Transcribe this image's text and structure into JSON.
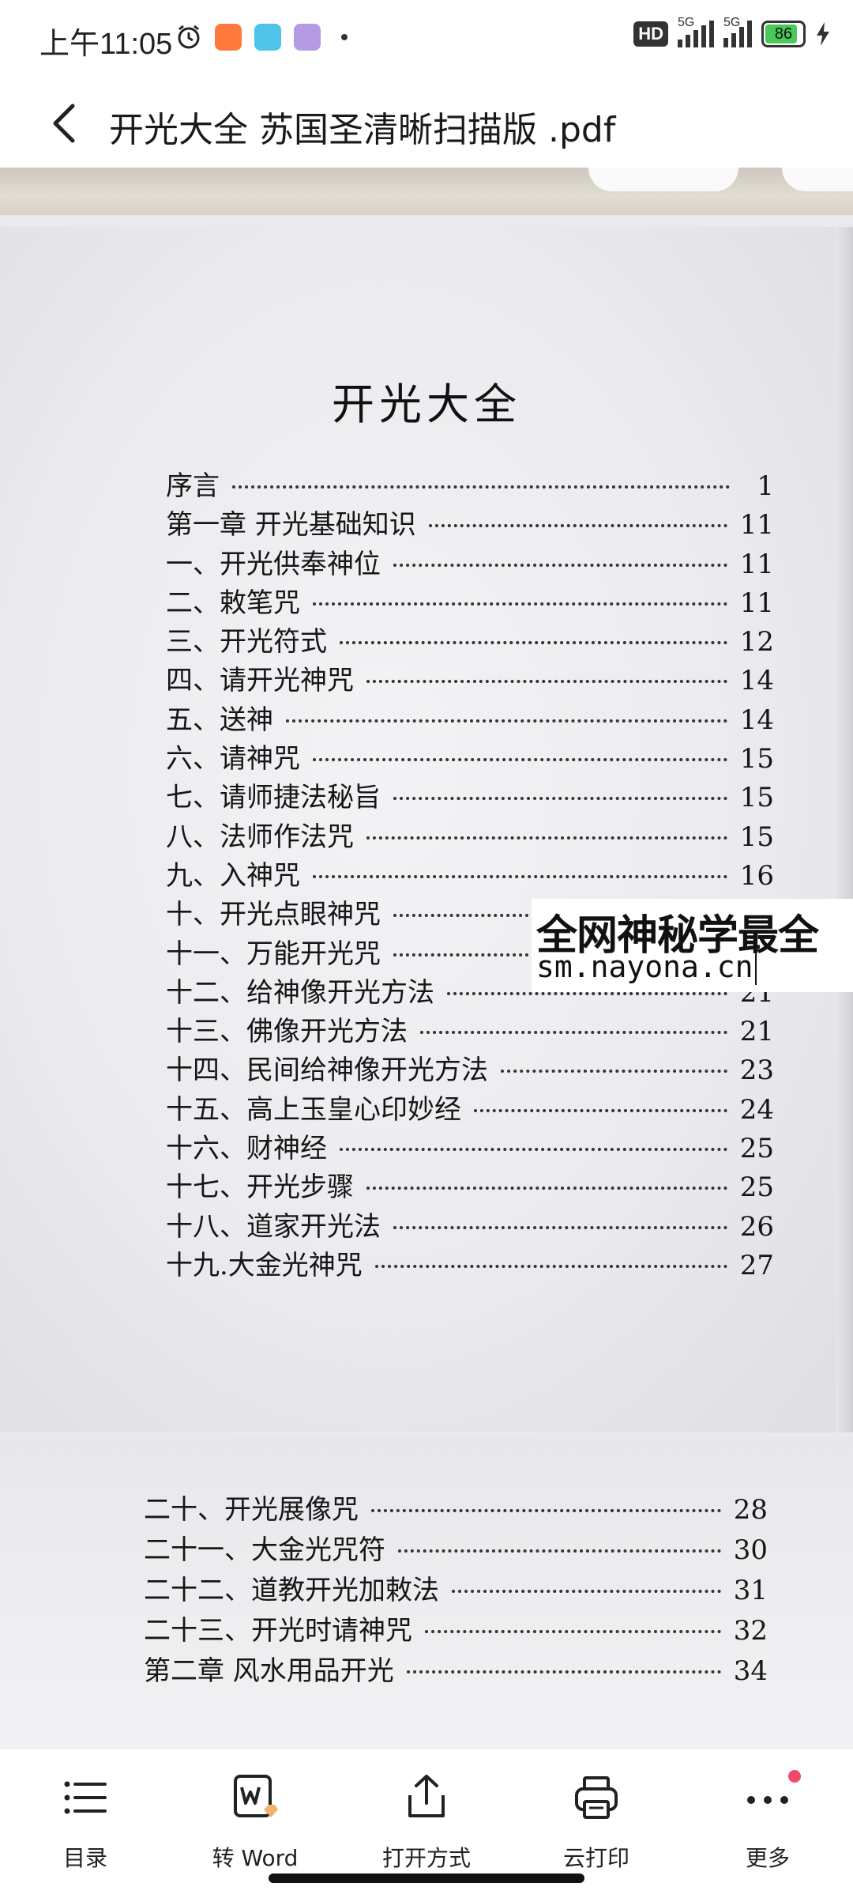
{
  "status_bar": {
    "time": "上午11:05",
    "hd_label": "HD",
    "network_1": "5G",
    "network_2": "5G",
    "battery": "86"
  },
  "header": {
    "title": "开光大全  苏国圣清晰扫描版 .pdf"
  },
  "document": {
    "title": "开光大全",
    "toc": [
      {
        "label": "序言",
        "page": "1"
      },
      {
        "label": "第一章  开光基础知识",
        "page": "11"
      },
      {
        "label": "一、开光供奉神位",
        "page": "11"
      },
      {
        "label": "二、敕笔咒",
        "page": "11"
      },
      {
        "label": "三、开光符式",
        "page": "12"
      },
      {
        "label": "四、请开光神咒",
        "page": "14"
      },
      {
        "label": "五、送神",
        "page": "14"
      },
      {
        "label": "六、请神咒",
        "page": "15"
      },
      {
        "label": "七、请师捷法秘旨",
        "page": "15"
      },
      {
        "label": "八、法师作法咒",
        "page": "15"
      },
      {
        "label": "九、入神咒",
        "page": "16"
      },
      {
        "label": "十、开光点眼神咒",
        "page": ""
      },
      {
        "label": "十一、万能开光咒",
        "page": ""
      },
      {
        "label": "十二、给神像开光方法",
        "page": "21"
      },
      {
        "label": "十三、佛像开光方法",
        "page": "21"
      },
      {
        "label": "十四、民间给神像开光方法",
        "page": "23"
      },
      {
        "label": "十五、高上玉皇心印妙经",
        "page": "24"
      },
      {
        "label": "十六、财神经",
        "page": "25"
      },
      {
        "label": "十七、开光步骤",
        "page": "25"
      },
      {
        "label": "十八、道家开光法",
        "page": "26"
      },
      {
        "label": "十九.大金光神咒",
        "page": "27"
      }
    ],
    "toc_page2": [
      {
        "label": "二十、开光展像咒",
        "page": "28"
      },
      {
        "label": "二十一、大金光咒符",
        "page": "30"
      },
      {
        "label": "二十二、道教开光加敕法",
        "page": "31"
      },
      {
        "label": "二十三、开光时请神咒",
        "page": "32"
      },
      {
        "label": "第二章  风水用品开光",
        "page": "34"
      }
    ],
    "watermark": {
      "line1": "全网神秘学最全",
      "line2": "sm.nayona.cn"
    }
  },
  "toolbar": {
    "items": [
      {
        "label": "目录",
        "icon": "list-icon"
      },
      {
        "label": "转 Word",
        "icon": "convert-word-icon"
      },
      {
        "label": "打开方式",
        "icon": "share-icon"
      },
      {
        "label": "云打印",
        "icon": "printer-icon"
      },
      {
        "label": "更多",
        "icon": "more-dots-icon"
      }
    ]
  },
  "colors": {
    "battery_fill": "#49c95a",
    "notification_dot": "#f2496b",
    "page_bg": "#ebebef"
  }
}
